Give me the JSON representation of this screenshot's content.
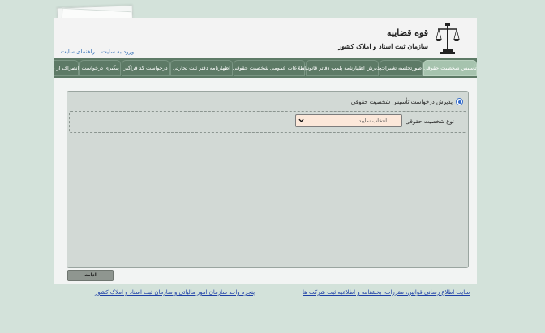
{
  "header": {
    "logo_line1": "قوه قضاییه",
    "logo_line2": "سازمان ثبت اسناد و املاک کشور",
    "links": [
      {
        "label": "ورود به سایت"
      },
      {
        "label": "راهنمای سایت"
      }
    ]
  },
  "nav": {
    "items": [
      {
        "label": "تأسیس شخصیت حقوقی"
      },
      {
        "label": "صورتجلسه تغییرات"
      },
      {
        "label": "پذیرش اظهارنامه پلمپ دفاتر قانونی"
      },
      {
        "label": "اطلاعات عمومی شخصیت حقوقی"
      },
      {
        "label": "اظهارنامه دفتر ثبت تجارتی"
      },
      {
        "label": "درخواست کد فراگیر"
      },
      {
        "label": "پیگیری درخواست"
      },
      {
        "label": "انصراف از درخواست"
      }
    ]
  },
  "form": {
    "radio_label": "پذیرش درخواست تأسیس شخصیت حقوقی",
    "field_label": "نوع شخصیت حقوقی",
    "select_value": "انتخاب نمایید ..."
  },
  "buttons": {
    "submit": "ادامه"
  },
  "footer": {
    "link_right": "سایت اطلاع رسانی قوانین، مقررات، بخشنامه و اطلاعیه ثبت شرکت ها",
    "link_left": "پنجره واحد سازمان امور مالیاتی و سازمان ثبت اسناد و املاک کشور"
  },
  "colors": {
    "background": "#d3e2da",
    "nav": "#5d7a66",
    "nav_active": "#a6c3ae",
    "select_bg": "#fce8da",
    "link": "#1d3fa6"
  }
}
